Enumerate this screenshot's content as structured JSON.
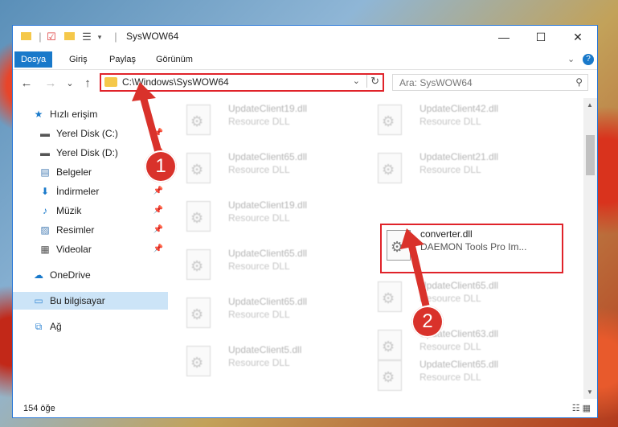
{
  "window": {
    "title": "SysWOW64",
    "minimize": "—",
    "maximize": "☐",
    "close": "✕"
  },
  "ribbon": {
    "tabs": [
      "Dosya",
      "Giriş",
      "Paylaş",
      "Görünüm"
    ],
    "expand": "⌄",
    "help": "?"
  },
  "nav": {
    "back": "←",
    "forward": "→",
    "recent": "⌄",
    "up": "↑",
    "address": "C:\\Windows\\SysWOW64",
    "dropdown": "⌄",
    "refresh": "↻",
    "search_placeholder": "Ara: SysWOW64",
    "search_icon": "⚲"
  },
  "sidebar": {
    "items": [
      {
        "label": "Hızlı erişim",
        "icon": "star-icon",
        "glyph": "★"
      },
      {
        "label": "Yerel Disk (C:)",
        "icon": "drive-icon",
        "glyph": "▬"
      },
      {
        "label": "Yerel Disk (D:)",
        "icon": "drive-icon",
        "glyph": "▬"
      },
      {
        "label": "Belgeler",
        "icon": "documents-icon",
        "glyph": "▤"
      },
      {
        "label": "İndirmeler",
        "icon": "download-icon",
        "glyph": "⬇"
      },
      {
        "label": "Müzik",
        "icon": "music-icon",
        "glyph": "♪"
      },
      {
        "label": "Resimler",
        "icon": "pictures-icon",
        "glyph": "▨"
      },
      {
        "label": "Videolar",
        "icon": "videos-icon",
        "glyph": "▦"
      },
      {
        "label": "OneDrive",
        "icon": "cloud-icon",
        "glyph": "☁"
      },
      {
        "label": "Bu bilgisayar",
        "icon": "computer-icon",
        "glyph": "▭"
      },
      {
        "label": "Ağ",
        "icon": "network-icon",
        "glyph": "⧉"
      }
    ],
    "pin": "📌"
  },
  "files": {
    "left": [
      {
        "name": "UpdateClient19.dll",
        "type": "Resource DLL"
      },
      {
        "name": "UpdateClient65.dll",
        "type": "Resource DLL"
      },
      {
        "name": "UpdateClient19.dll",
        "type": "Resource DLL"
      },
      {
        "name": "UpdateClient65.dll",
        "type": "Resource DLL"
      },
      {
        "name": "UpdateClient65.dll",
        "type": "Resource DLL"
      },
      {
        "name": "UpdateClient5.dll",
        "type": "Resource DLL"
      }
    ],
    "right": [
      {
        "name": "UpdateClient42.dll",
        "type": "Resource DLL"
      },
      {
        "name": "UpdateClient21.dll",
        "type": "Resource DLL"
      },
      {
        "name": "converter.dll",
        "type": "DAEMON Tools Pro Im..."
      },
      {
        "name": "UpdateClient65.dll",
        "type": "Resource DLL"
      },
      {
        "name": "UpdateClient63.dll",
        "type": "Resource DLL"
      },
      {
        "name": "UpdateClient65.dll",
        "type": "Resource DLL"
      }
    ],
    "file_glyph": "⚙"
  },
  "status": {
    "count": "154 öğe",
    "views": "☷ ▦"
  },
  "callouts": [
    "1",
    "2"
  ],
  "colors": {
    "accent": "#1979ca",
    "highlight": "#e0232a",
    "badge": "#d9322b"
  }
}
